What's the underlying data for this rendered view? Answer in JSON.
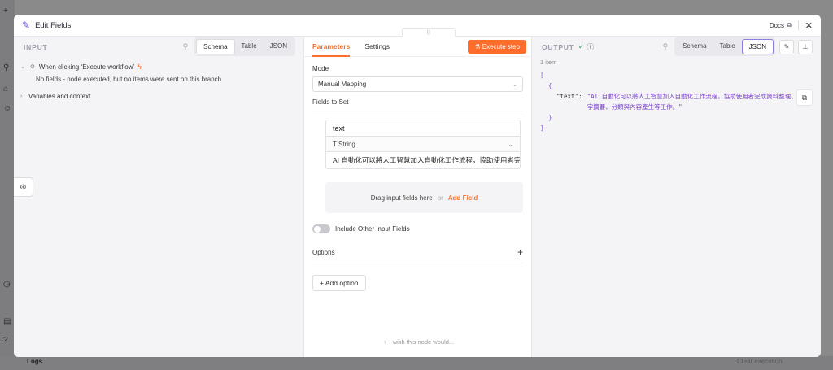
{
  "modal": {
    "title": "Edit Fields",
    "docs_label": "Docs",
    "docs_icon": "external-link-icon",
    "close_label": "✕"
  },
  "input_panel": {
    "title": "INPUT",
    "view_tabs": [
      "Schema",
      "Table",
      "JSON"
    ],
    "active_tab": "Schema",
    "trigger_label": "When clicking ‘Execute workflow’",
    "no_fields_text": "No fields - node executed, but no items were sent on this branch",
    "variables_label": "Variables and context"
  },
  "params_panel": {
    "tabs": [
      "Parameters",
      "Settings"
    ],
    "active_tab": "Parameters",
    "execute_label": "Execute step",
    "mode_label": "Mode",
    "mode_value": "Manual Mapping",
    "fields_to_set_label": "Fields to Set",
    "field": {
      "name": "text",
      "type": "String",
      "value": "AI 自動化可以將人工智慧加入自動化工作流程，協助使用者完成資料整理、文字摘要、分類與內容產生等工作。"
    },
    "drop_zone_text": "Drag input fields here",
    "drop_zone_or": "or",
    "add_field_label": "Add Field",
    "include_other_label": "Include Other Input Fields",
    "include_other_enabled": false,
    "options_label": "Options",
    "add_option_label": "Add option",
    "wish_text": "I wish this node would..."
  },
  "output_panel": {
    "title": "OUTPUT",
    "view_tabs": [
      "Schema",
      "Table",
      "JSON"
    ],
    "active_tab": "JSON",
    "item_count": "1 item",
    "json_key": "\"text\":",
    "json_value": "\"AI 自動化可以將人工智慧加入自動化工作流程，協助使用者完成資料整理、文字摘要、分類與內容產生等工作。\""
  },
  "background": {
    "logs_label": "Logs",
    "clear_label": "Clear execution"
  },
  "colors": {
    "accent": "#ff6d2c",
    "purple": "#8b7fe0",
    "success": "#27a85e"
  }
}
